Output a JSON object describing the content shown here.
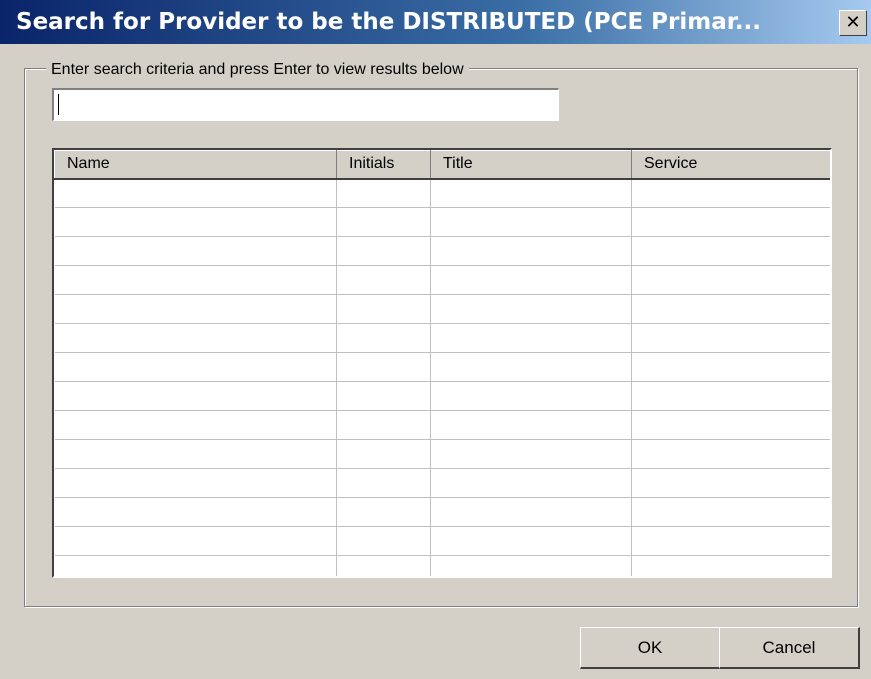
{
  "window": {
    "title": "Search for Provider to be the DISTRIBUTED (PCE Primar...",
    "close_glyph": "✕"
  },
  "search": {
    "legend": "Enter search criteria and press Enter to view results below",
    "value": "",
    "placeholder": ""
  },
  "results": {
    "columns": [
      "Name",
      "Initials",
      "Title",
      "Service"
    ],
    "rows": [
      [
        "",
        "",
        "",
        ""
      ],
      [
        "",
        "",
        "",
        ""
      ],
      [
        "",
        "",
        "",
        ""
      ],
      [
        "",
        "",
        "",
        ""
      ],
      [
        "",
        "",
        "",
        ""
      ],
      [
        "",
        "",
        "",
        ""
      ],
      [
        "",
        "",
        "",
        ""
      ],
      [
        "",
        "",
        "",
        ""
      ],
      [
        "",
        "",
        "",
        ""
      ],
      [
        "",
        "",
        "",
        ""
      ],
      [
        "",
        "",
        "",
        ""
      ],
      [
        "",
        "",
        "",
        ""
      ],
      [
        "",
        "",
        "",
        ""
      ],
      [
        "",
        "",
        "",
        ""
      ]
    ]
  },
  "buttons": {
    "ok": "OK",
    "cancel": "Cancel"
  },
  "colors": {
    "titlebar_start": "#0a246a",
    "titlebar_end": "#a6caf0",
    "face": "#d4d0c8"
  },
  "icons": {
    "close": "close-icon"
  }
}
